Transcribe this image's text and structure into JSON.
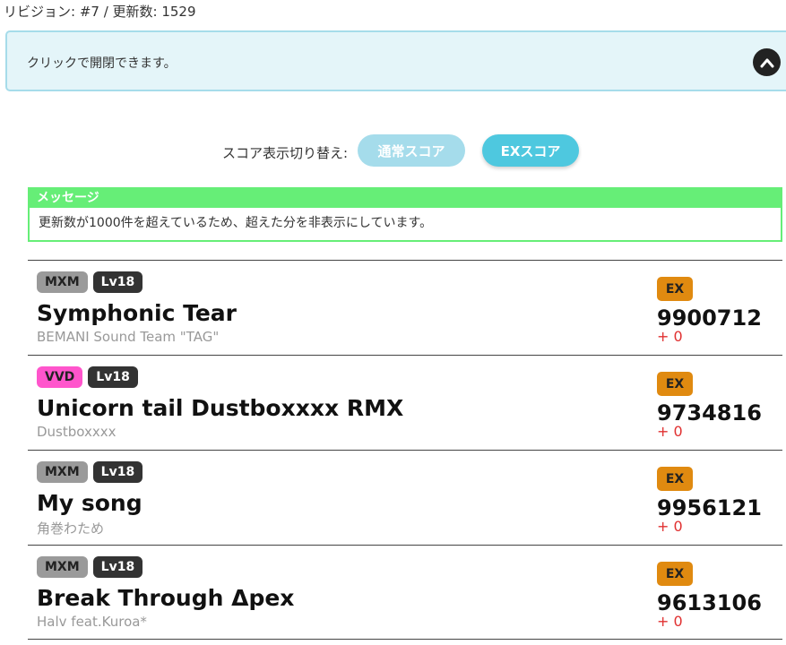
{
  "revision": "リビジョン: #7 / 更新数: 1529",
  "info_box": {
    "text": "クリックで開閉できます。"
  },
  "score_switch": {
    "label": "スコア表示切り替え:",
    "normal": "通常スコア",
    "ex": "EXスコア"
  },
  "message": {
    "header": "メッセージ",
    "body": "更新数が1000件を超えているため、超えた分を非表示にしています。"
  },
  "songs": [
    {
      "difficulty": "MXM",
      "level": "Lv18",
      "title": "Symphonic Tear",
      "artist": "BEMANI Sound Team \"TAG\"",
      "score_type": "EX",
      "score": "9900712",
      "diff": "+ 0"
    },
    {
      "difficulty": "VVD",
      "level": "Lv18",
      "title": "Unicorn tail Dustboxxxx RMX",
      "artist": "Dustboxxxx",
      "score_type": "EX",
      "score": "9734816",
      "diff": "+ 0"
    },
    {
      "difficulty": "MXM",
      "level": "Lv18",
      "title": "My song",
      "artist": "角巻わため",
      "score_type": "EX",
      "score": "9956121",
      "diff": "+ 0"
    },
    {
      "difficulty": "MXM",
      "level": "Lv18",
      "title": "Break Through Δpex",
      "artist": "Halv feat.Kuroa*",
      "score_type": "EX",
      "score": "9613106",
      "diff": "+ 0"
    }
  ],
  "colors": {
    "info_bg": "#e4f5f9",
    "message_green": "#66ee77",
    "ex_badge": "#e08a10",
    "diff_red": "#e03030"
  },
  "icons": {
    "toggle": "chevron-up-icon"
  }
}
